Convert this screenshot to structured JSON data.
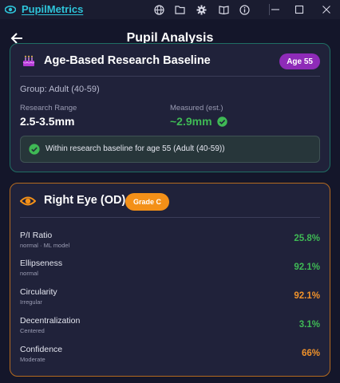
{
  "titlebar": {
    "app_name": "PupilMetrics",
    "icons": [
      "globe-icon",
      "folder-icon",
      "gear-icon",
      "book-icon",
      "info-icon"
    ],
    "window_controls": [
      "minimize-icon",
      "maximize-icon",
      "close-icon"
    ]
  },
  "header": {
    "title": "Pupil Analysis"
  },
  "baseline": {
    "title": "Age-Based Research Baseline",
    "age_badge": "Age 55",
    "group": "Group: Adult (40-59)",
    "range_label": "Research Range",
    "range_value": "2.5-3.5mm",
    "measured_label": "Measured (est.)",
    "measured_value": "~2.9mm",
    "status": "Within research baseline for age 55 (Adult (40-59))"
  },
  "eye": {
    "title": "Right Eye (OD)",
    "grade": "Grade C",
    "metrics": [
      {
        "name": "P/I Ratio",
        "sub": "normal · ML model",
        "value": "25.8%",
        "status": "good"
      },
      {
        "name": "Ellipseness",
        "sub": "normal",
        "value": "92.1%",
        "status": "good"
      },
      {
        "name": "Circularity",
        "sub": "Irregular",
        "value": "92.1%",
        "status": "warn"
      },
      {
        "name": "Decentralization",
        "sub": "Centered",
        "value": "3.1%",
        "status": "good"
      },
      {
        "name": "Confidence",
        "sub": "Moderate",
        "value": "66%",
        "status": "warn"
      }
    ]
  },
  "colors": {
    "accent": "#2ec4d9",
    "good": "#3fb955",
    "warn": "#f0922a",
    "age_badge": "#8e2bb8",
    "grade_badge": "#f39018"
  }
}
